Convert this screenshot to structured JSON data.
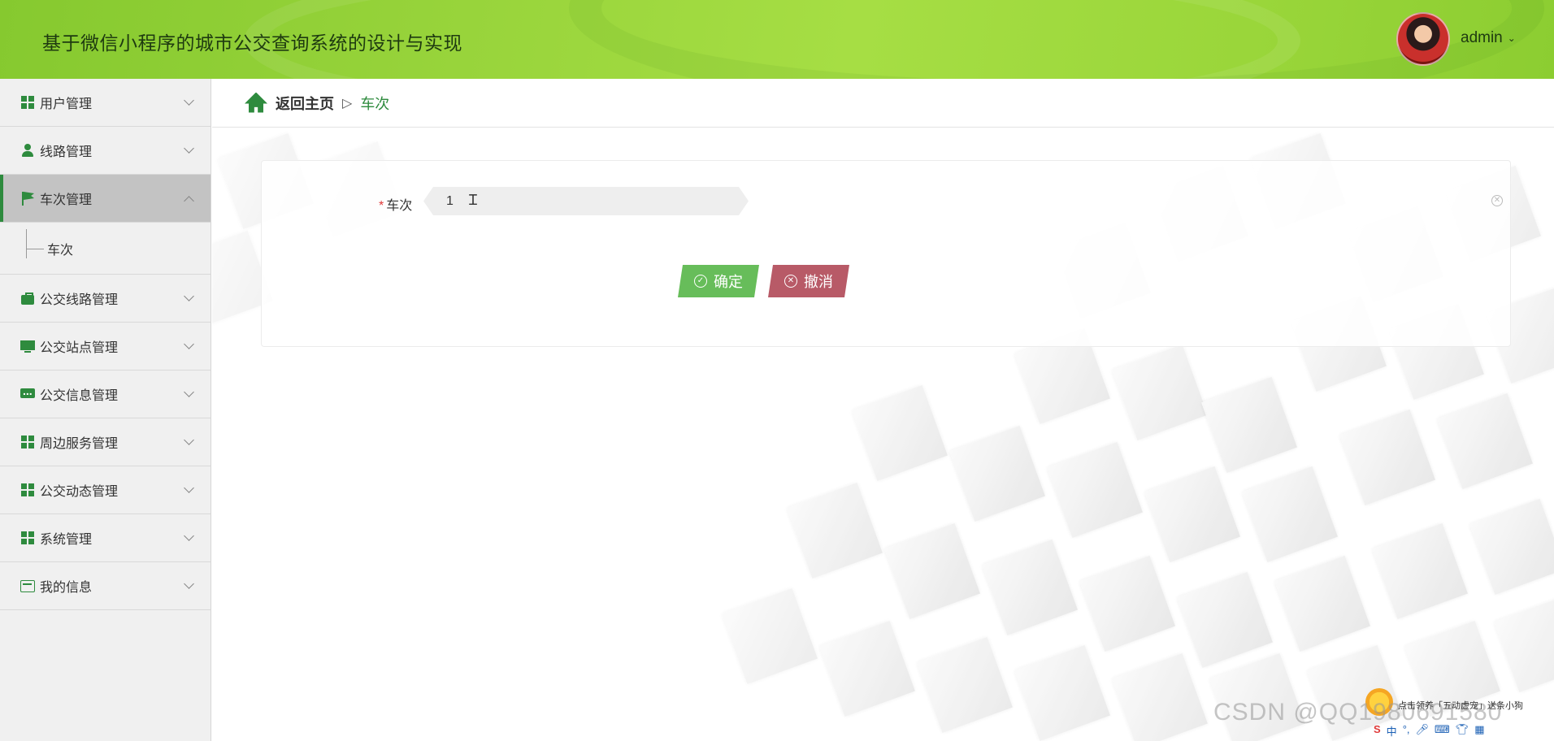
{
  "header": {
    "title": "基于微信小程序的城市公交查询系统的设计与实现",
    "username": "admin"
  },
  "sidebar": {
    "items": [
      {
        "label": "用户管理",
        "icon": "grid-icon"
      },
      {
        "label": "线路管理",
        "icon": "user-icon"
      },
      {
        "label": "车次管理",
        "icon": "flag-icon",
        "active": true,
        "expanded": true,
        "children": [
          {
            "label": "车次"
          }
        ]
      },
      {
        "label": "公交线路管理",
        "icon": "briefcase-icon"
      },
      {
        "label": "公交站点管理",
        "icon": "monitor-icon"
      },
      {
        "label": "公交信息管理",
        "icon": "chat-icon"
      },
      {
        "label": "周边服务管理",
        "icon": "grid-icon"
      },
      {
        "label": "公交动态管理",
        "icon": "grid-icon"
      },
      {
        "label": "系统管理",
        "icon": "grid-icon"
      },
      {
        "label": "我的信息",
        "icon": "card-icon"
      }
    ]
  },
  "breadcrumb": {
    "home": "返回主页",
    "separator": "▷",
    "current": "车次"
  },
  "form": {
    "field_label": "车次",
    "required_mark": "*",
    "field_value": "1",
    "ok_label": "确定",
    "cancel_label": "撤消"
  },
  "overlay": {
    "watermark": "CSDN @QQ1980691580",
    "tray_note": "点击领养「五动虚宠」送条小狗",
    "tray_ime": "中"
  },
  "colors": {
    "header_green": "#9ad63a",
    "accent_green": "#2e8b3e",
    "ok_button": "#67bd5a",
    "cancel_button": "#b85a67",
    "active_menu_bg": "#c3c3c3"
  }
}
